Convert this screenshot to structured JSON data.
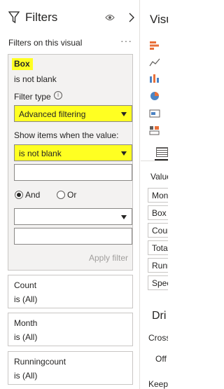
{
  "filters_pane": {
    "title": "Filters",
    "section_label": "Filters on this visual",
    "more_label": "···",
    "active_filter": {
      "field": "Box",
      "condition": "is not blank",
      "filter_type_label": "Filter type",
      "filter_type_value": "Advanced filtering",
      "show_items_label": "Show items when the value:",
      "condition_1_operator": "is not blank",
      "condition_1_value": "",
      "logic_and_label": "And",
      "logic_or_label": "Or",
      "logic_selected": "And",
      "condition_2_operator": "",
      "condition_2_value": "",
      "apply_label": "Apply filter"
    },
    "collapsed_filters": [
      {
        "field": "Count",
        "condition": "is (All)"
      },
      {
        "field": "Month",
        "condition": "is (All)"
      },
      {
        "field": "Runningcount",
        "condition": "is (All)"
      }
    ]
  },
  "viz_pane": {
    "title": "Visu",
    "values_label": "Value",
    "fields": [
      "Mont",
      "Box",
      "Coun",
      "Total",
      "Runn",
      "Spec"
    ],
    "drill_title": "Dri",
    "cross_label": "Cross",
    "off_label": "Off",
    "keep_label": "Keep"
  },
  "colors": {
    "highlight": "#ffff22",
    "accent_orange": "#e8703a",
    "accent_blue": "#4c83c3"
  }
}
